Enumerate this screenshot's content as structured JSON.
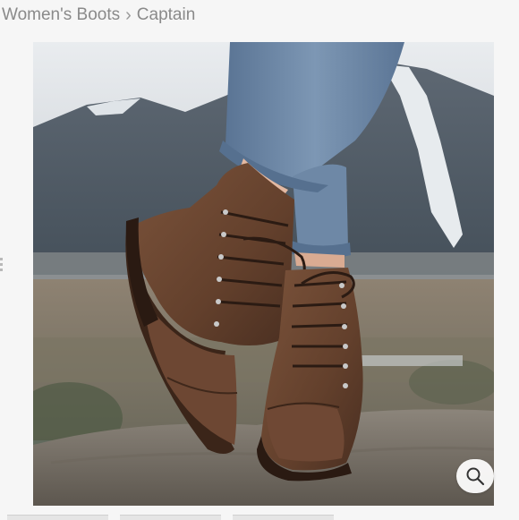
{
  "breadcrumb": {
    "parent": "Women's Boots",
    "separator": "›",
    "current": "Captain"
  },
  "product_image": {
    "subject": "brown leather lace-up cap-toe boots on a rock with mountains",
    "zoom_icon": "magnifier-icon"
  },
  "thumbnails": [
    {
      "name": "thumbnail-1"
    },
    {
      "name": "thumbnail-2"
    },
    {
      "name": "thumbnail-3"
    }
  ],
  "colors": {
    "breadcrumb_text": "#8a8a8a",
    "page_background": "#f6f6f6",
    "leather": "#6b4430",
    "denim": "#6f8aa6"
  }
}
